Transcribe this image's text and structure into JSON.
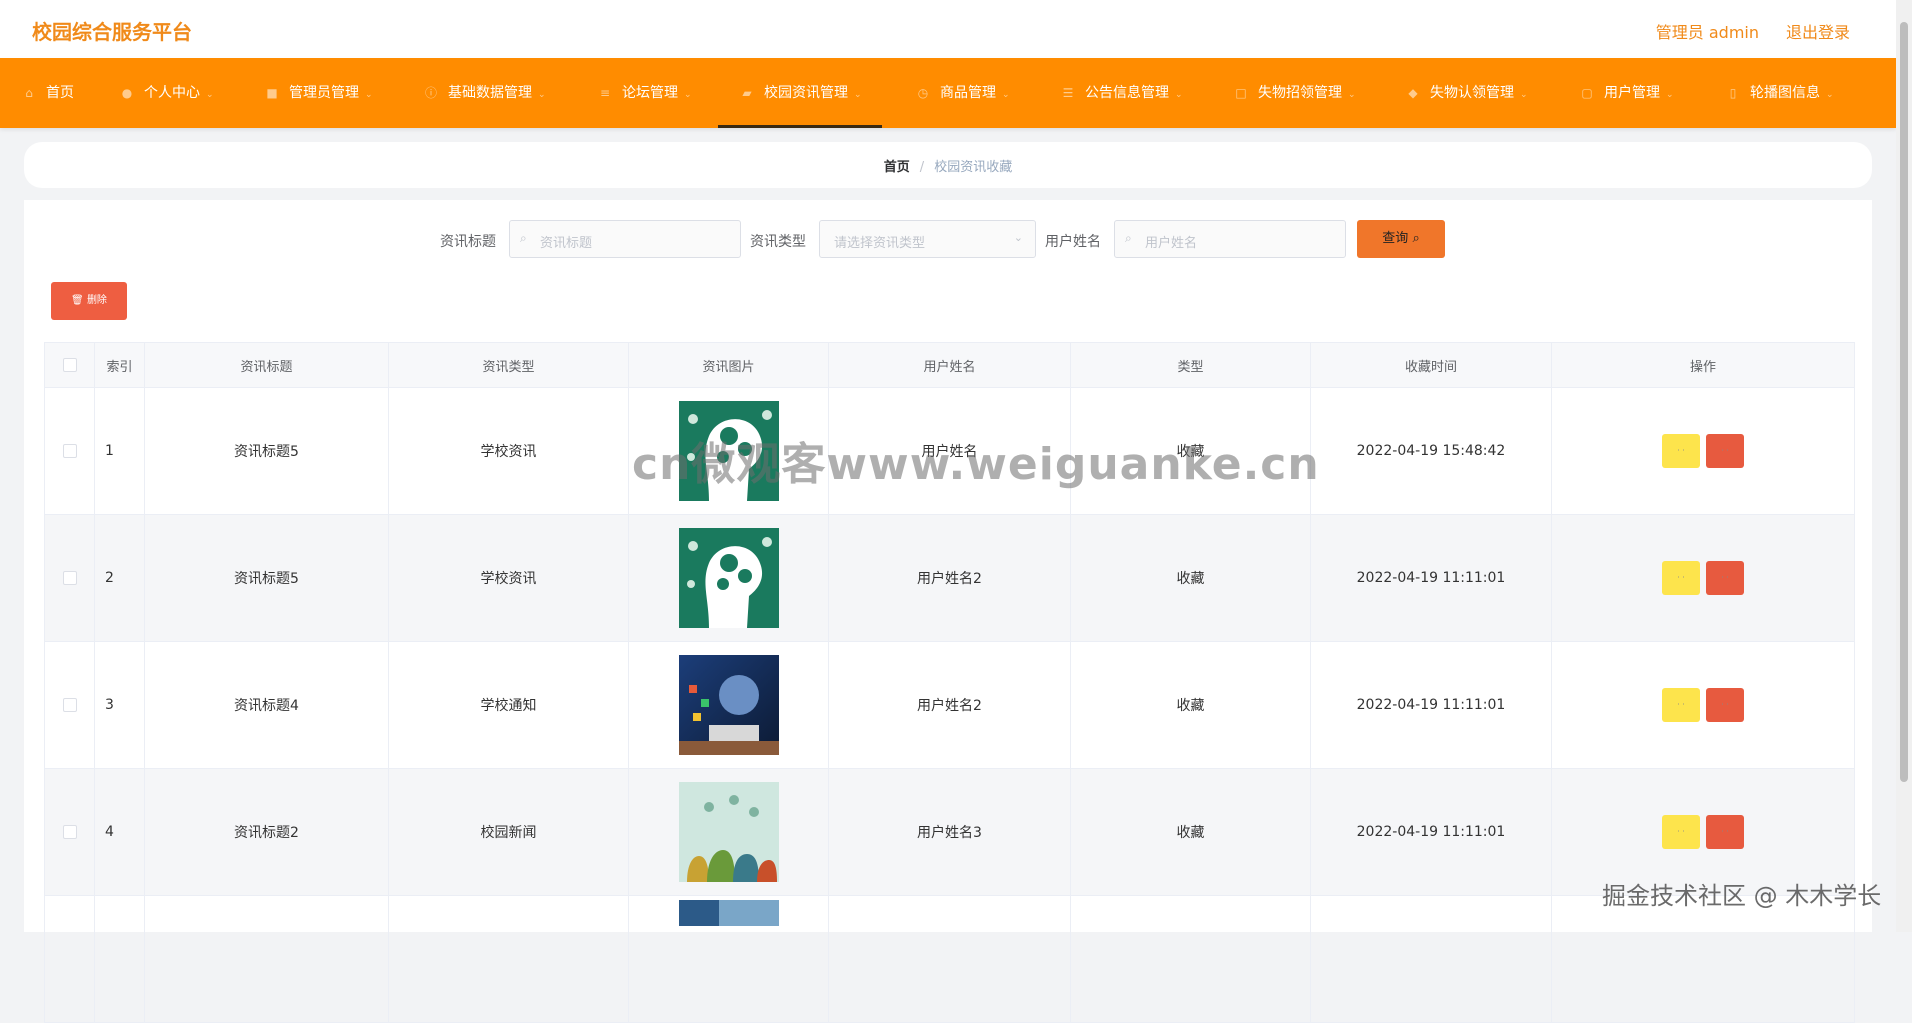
{
  "header": {
    "app_title": "校园综合服务平台",
    "admin_label": "管理员 admin",
    "logout": "退出登录"
  },
  "nav": {
    "items": [
      {
        "label": "首页",
        "icon": "home-icon"
      },
      {
        "label": "个人中心",
        "icon": "user-icon"
      },
      {
        "label": "管理员管理",
        "icon": "admin-icon"
      },
      {
        "label": "基础数据管理",
        "icon": "info-icon"
      },
      {
        "label": "论坛管理",
        "icon": "forum-icon"
      },
      {
        "label": "校园资讯管理",
        "icon": "news-icon"
      },
      {
        "label": "商品管理",
        "icon": "goods-icon"
      },
      {
        "label": "公告信息管理",
        "icon": "notice-icon"
      },
      {
        "label": "失物招领管理",
        "icon": "lost-icon"
      },
      {
        "label": "失物认领管理",
        "icon": "claim-icon"
      },
      {
        "label": "用户管理",
        "icon": "users-icon"
      },
      {
        "label": "轮播图信息",
        "icon": "carousel-icon"
      }
    ],
    "active_index": 5
  },
  "breadcrumb": {
    "home": "首页",
    "separator": "/",
    "current": "校园资讯收藏"
  },
  "filters": {
    "title_label": "资讯标题",
    "title_placeholder": "资讯标题",
    "type_label": "资讯类型",
    "type_placeholder": "请选择资讯类型",
    "user_label": "用户姓名",
    "user_placeholder": "用户姓名",
    "query_label": "查询"
  },
  "actions": {
    "delete_label": "删除"
  },
  "table": {
    "columns": [
      "索引",
      "资讯标题",
      "资讯类型",
      "资讯图片",
      "用户姓名",
      "类型",
      "收藏时间",
      "操作"
    ],
    "rows": [
      {
        "index": "1",
        "title": "资讯标题5",
        "type": "学校资讯",
        "image": "brain-gears",
        "user": "用户姓名",
        "kind": "收藏",
        "time": "2022-04-19 15:48:42"
      },
      {
        "index": "2",
        "title": "资讯标题5",
        "type": "学校资讯",
        "image": "brain-gears",
        "user": "用户姓名2",
        "kind": "收藏",
        "time": "2022-04-19 11:11:01"
      },
      {
        "index": "3",
        "title": "资讯标题4",
        "type": "学校通知",
        "image": "tech-globe",
        "user": "用户姓名2",
        "kind": "收藏",
        "time": "2022-04-19 11:11:01"
      },
      {
        "index": "4",
        "title": "资讯标题2",
        "type": "校园新闻",
        "image": "people-network",
        "user": "用户姓名3",
        "kind": "收藏",
        "time": "2022-04-19 11:11:01"
      }
    ]
  },
  "watermarks": {
    "center": "cn微观客www.weiguanke.cn",
    "corner": "掘金技术社区 @ 木木学长"
  },
  "colors": {
    "brand": "#f08a1a",
    "nav_bg": "#ff8c00",
    "query_btn": "#f0762a",
    "delete_btn": "#ee5e41",
    "edit_op": "#fde44c",
    "delete_op": "#e75a3f"
  }
}
